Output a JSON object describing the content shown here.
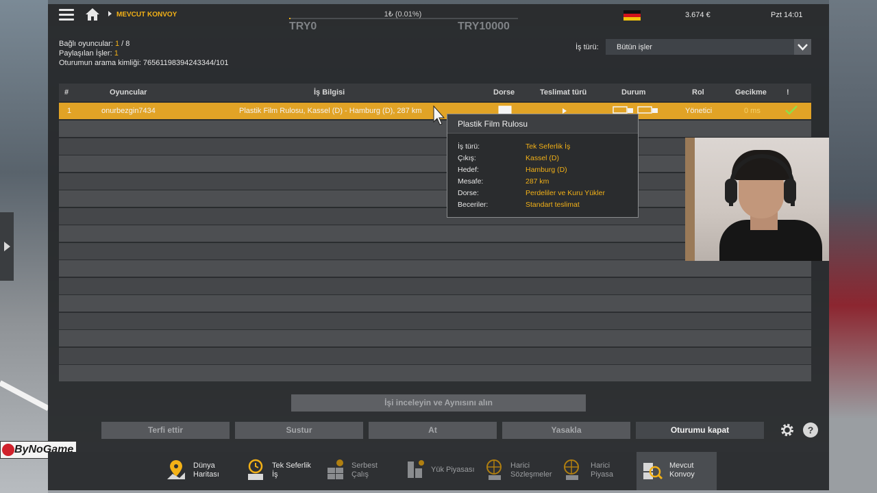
{
  "topbar": {
    "breadcrumb": "MEVCUT KONVOY",
    "progress_label": "1₺ (0.01%)",
    "progress_fraction": 0.0001,
    "try_min": "TRY0",
    "try_max": "TRY10000",
    "money": "3.674 €",
    "clock": "Pzt 14:01"
  },
  "session": {
    "connected_label": "Bağlı oyuncular:",
    "connected_value": "1",
    "connected_sep": " / ",
    "connected_max": "8",
    "shared_label": "Paylaşılan İşler:",
    "shared_value": "1",
    "search_id_label": "Oturumun arama kimliği:",
    "search_id_value": "76561198394243344/101"
  },
  "filter": {
    "label": "İş türü:",
    "value": "Bütün işler"
  },
  "table": {
    "headers": {
      "num": "#",
      "players": "Oyuncular",
      "job": "İş Bilgisi",
      "trailer": "Dorse",
      "delivery": "Teslimat türü",
      "status": "Durum",
      "role": "Rol",
      "delay": "Gecikme",
      "alert": "!"
    },
    "rows": [
      {
        "num": "1",
        "player": "onurbezgin7434",
        "job": "Plastik Film Rulosu, Kassel (D) - Hamburg (D), 287 km",
        "role": "Yönetici",
        "delay": "0 ms"
      }
    ]
  },
  "tooltip": {
    "title": "Plastik Film Rulosu",
    "rows": [
      {
        "label": "İş türü:",
        "value": "Tek Seferlik İş"
      },
      {
        "label": "Çıkış:",
        "value": "Kassel (D)"
      },
      {
        "label": "Hedef:",
        "value": "Hamburg (D)"
      },
      {
        "label": "Mesafe:",
        "value": "287 km"
      },
      {
        "label": "Dorse:",
        "value": "Perdeliler ve Kuru Yükler"
      },
      {
        "label": "Beceriler:",
        "value": "Standart teslimat"
      }
    ]
  },
  "actions": {
    "inspect": "İşi inceleyin ve Aynısını alın",
    "promote": "Terfi ettir",
    "mute": "Sustur",
    "kick": "At",
    "ban": "Yasakla",
    "close_session": "Oturumu kapat"
  },
  "watermark": "ByNoGame",
  "nav": [
    {
      "label": "Dünya\nHaritası",
      "icon": "world-map-icon"
    },
    {
      "label": "Tek Seferlik\nİş",
      "icon": "clock-job-icon"
    },
    {
      "label": "Serbest\nÇalış",
      "icon": "freelance-icon"
    },
    {
      "label": "Yük Piyasası",
      "icon": "cargo-market-icon"
    },
    {
      "label": "Harici\nSözleşmeler",
      "icon": "external-contracts-icon"
    },
    {
      "label": "Harici\nPiyasa",
      "icon": "external-market-icon"
    },
    {
      "label": "Mevcut\nKonvoy",
      "icon": "current-convoy-icon"
    }
  ],
  "colors": {
    "accent": "#f3b117",
    "selected_row": "#e1a326",
    "panel": "#2b2d2f"
  }
}
